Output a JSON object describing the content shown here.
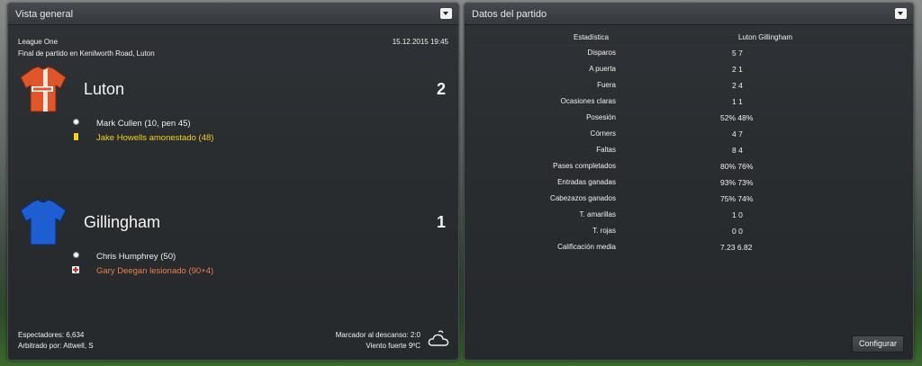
{
  "overview": {
    "title": "Vista general",
    "competition": "League One",
    "datetime": "15.12.2015 19:45",
    "venue": "Final de partido en Kenilworth Road, Luton",
    "home": {
      "name": "Luton",
      "score": "2",
      "events": [
        {
          "type": "goal",
          "text": "Mark Cullen (10, pen 45)"
        },
        {
          "type": "yellow-card",
          "text": "Jake Howells amonestado (48)"
        }
      ]
    },
    "away": {
      "name": "Gillingham",
      "score": "1",
      "events": [
        {
          "type": "goal",
          "text": "Chris Humphrey (50)"
        },
        {
          "type": "injury",
          "text": "Gary Deegan lesionado (90+4)"
        }
      ]
    },
    "attendance": "Espectadores: 6,634",
    "referee": "Arbitrado por: Attwell, S",
    "halftime": "Marcador al descanso: 2:0",
    "weather": "Viento fuerte 9ºC",
    "colors": {
      "luton_shirt": "#e0552a",
      "gillingham_shirt": "#1d5fd3",
      "yellow_event": "#f2d21c",
      "orange_event": "#e8804a"
    }
  },
  "match_stats": {
    "title": "Datos del partido",
    "stat_header": "Estadística",
    "teams_header": "Luton Gillingham",
    "rows": [
      {
        "label": "Disparos",
        "values": "5 7"
      },
      {
        "label": "A puerta",
        "values": "2 1"
      },
      {
        "label": "Fuera",
        "values": "2 4"
      },
      {
        "label": "Ocasiones claras",
        "values": "1 1"
      },
      {
        "label": "Posesión",
        "values": "52% 48%"
      },
      {
        "label": "Córners",
        "values": "4 7"
      },
      {
        "label": "Faltas",
        "values": "8 4"
      },
      {
        "label": "Pases completados",
        "values": "80% 76%"
      },
      {
        "label": "Entradas ganadas",
        "values": "93% 73%"
      },
      {
        "label": "Cabezazos ganados",
        "values": "75% 74%"
      },
      {
        "label": "T. amarillas",
        "values": "1 0"
      },
      {
        "label": "T. rojas",
        "values": "0 0"
      },
      {
        "label": "Calificación media",
        "values": "7.23 6.82"
      }
    ],
    "configure_label": "Configurar"
  }
}
